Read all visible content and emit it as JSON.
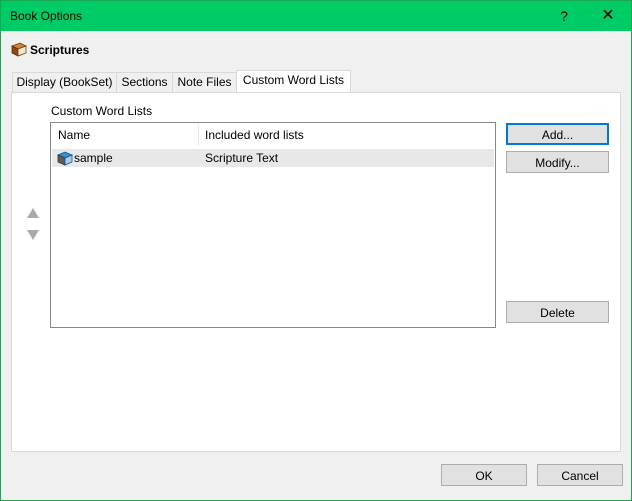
{
  "window": {
    "title": "Book Options",
    "help_glyph": "?",
    "close_glyph": "✕"
  },
  "book": {
    "icon": "book-icon",
    "title": "Scriptures"
  },
  "tabs": [
    {
      "label": "Display (BookSet)"
    },
    {
      "label": "Sections"
    },
    {
      "label": "Note Files"
    },
    {
      "label": "Custom Word Lists",
      "active": true
    }
  ],
  "panel": {
    "group_label": "Custom Word Lists",
    "columns": [
      "Name",
      "Included word lists"
    ],
    "rows": [
      {
        "icon": "word-list-icon",
        "name": "sample",
        "included": "Scripture Text"
      }
    ],
    "buttons": {
      "add": "Add...",
      "modify": "Modify...",
      "delete": "Delete"
    },
    "reorder": {
      "up": "arrow-up-icon",
      "down": "arrow-down-icon"
    }
  },
  "footer": {
    "ok": "OK",
    "cancel": "Cancel"
  },
  "colors": {
    "titlebar": "#00cc66",
    "panel_bg": "#ffffff",
    "dialog_bg": "#f0f0f0",
    "selected_row": "#e8e8e8",
    "focus_border": "#0078d7"
  }
}
